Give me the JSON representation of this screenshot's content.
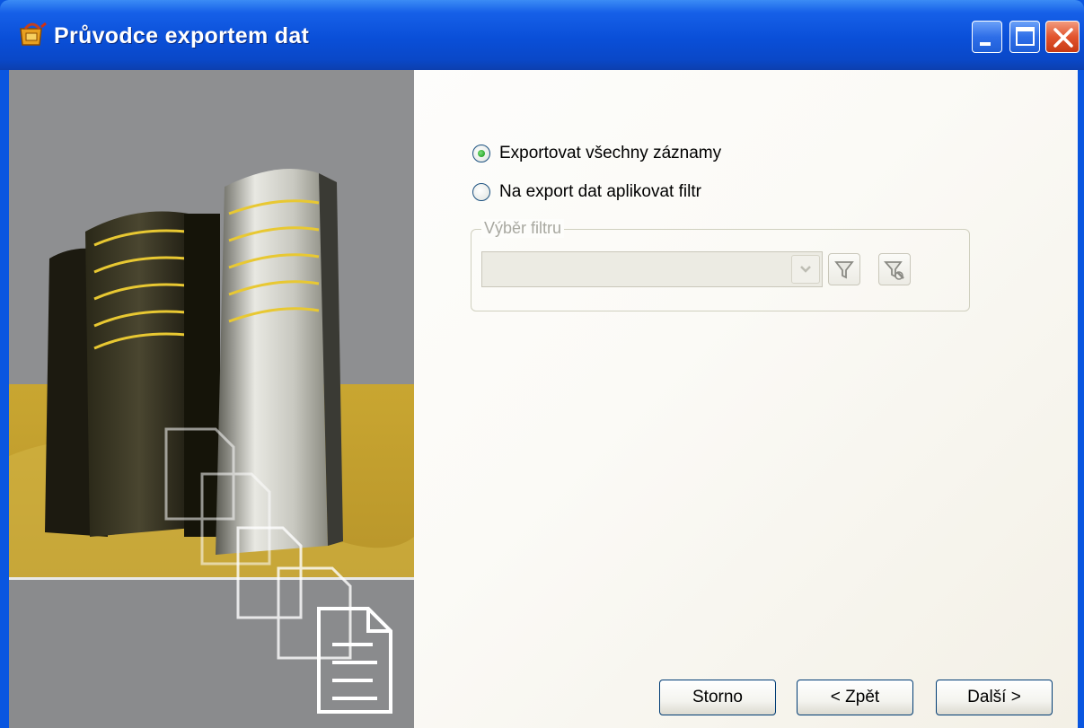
{
  "window": {
    "title": "Průvodce exportem dat"
  },
  "titlebar_buttons": {
    "minimize_icon": "minimize-icon",
    "maximize_icon": "maximize-icon",
    "close_icon": "close-icon"
  },
  "export_options": {
    "all_records_label": "Exportovat všechny záznamy",
    "all_records_selected": true,
    "apply_filter_label": "Na export dat aplikovat filtr",
    "apply_filter_selected": false
  },
  "filter_group": {
    "legend": "Výběr filtru",
    "combo_value": "",
    "combo_enabled": false,
    "filter_icon": "funnel-icon",
    "edit_filter_icon": "funnel-edit-icon"
  },
  "footer": {
    "cancel_label": "Storno",
    "back_label": "< Zpět",
    "next_label": "Další >"
  },
  "colors": {
    "titlebar": "#0a4fd8",
    "close_button": "#e2542e",
    "accent_radio": "#21a121",
    "art_sky": "#8e8f91",
    "art_floor": "#c9a631"
  }
}
